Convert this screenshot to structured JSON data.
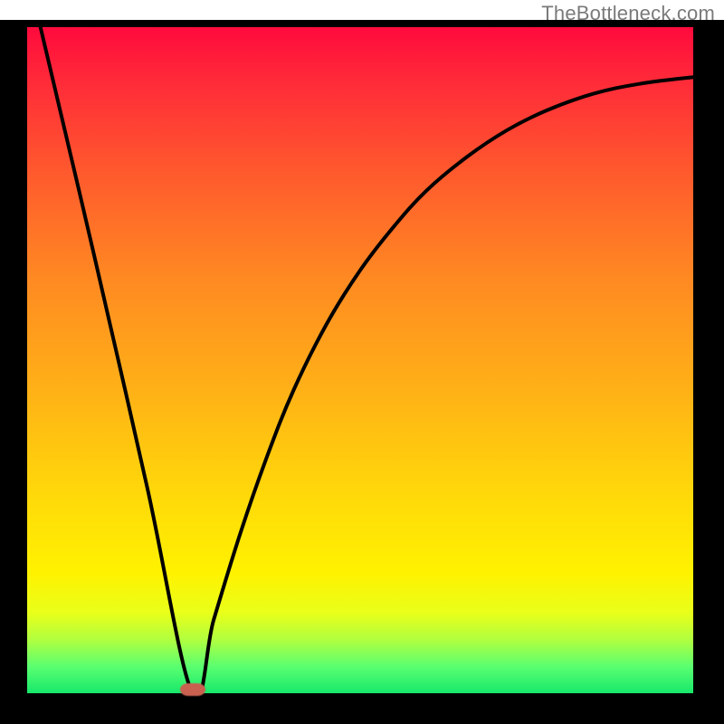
{
  "watermark": "TheBottleneck.com",
  "colors": {
    "frame": "#000000",
    "curve": "#000000",
    "blob": "#c96050",
    "gradient_stops": [
      {
        "pos": 0.0,
        "color": "#ff0a3c"
      },
      {
        "pos": 0.08,
        "color": "#ff2a39"
      },
      {
        "pos": 0.22,
        "color": "#ff5a2d"
      },
      {
        "pos": 0.38,
        "color": "#ff8a22"
      },
      {
        "pos": 0.55,
        "color": "#ffb216"
      },
      {
        "pos": 0.7,
        "color": "#ffd80a"
      },
      {
        "pos": 0.82,
        "color": "#fff200"
      },
      {
        "pos": 0.88,
        "color": "#e8ff1a"
      },
      {
        "pos": 0.92,
        "color": "#b0ff40"
      },
      {
        "pos": 0.96,
        "color": "#5aff70"
      },
      {
        "pos": 1.0,
        "color": "#17e86b"
      }
    ]
  },
  "chart_data": {
    "type": "line",
    "title": "",
    "xlabel": "",
    "ylabel": "",
    "xlim": [
      0,
      1
    ],
    "ylim": [
      0,
      1
    ],
    "annotations": [
      {
        "type": "marker",
        "x": 0.248,
        "y": 0.0,
        "label": "minimum-blob"
      }
    ],
    "series": [
      {
        "name": "bottleneck-curve",
        "x": [
          0.02,
          0.1,
          0.18,
          0.248,
          0.28,
          0.32,
          0.36,
          0.4,
          0.45,
          0.5,
          0.55,
          0.6,
          0.66,
          0.72,
          0.78,
          0.85,
          0.92,
          1.0
        ],
        "y": [
          1.0,
          0.66,
          0.31,
          0.0,
          0.11,
          0.24,
          0.355,
          0.455,
          0.555,
          0.635,
          0.7,
          0.755,
          0.805,
          0.845,
          0.875,
          0.9,
          0.915,
          0.925
        ]
      }
    ]
  }
}
